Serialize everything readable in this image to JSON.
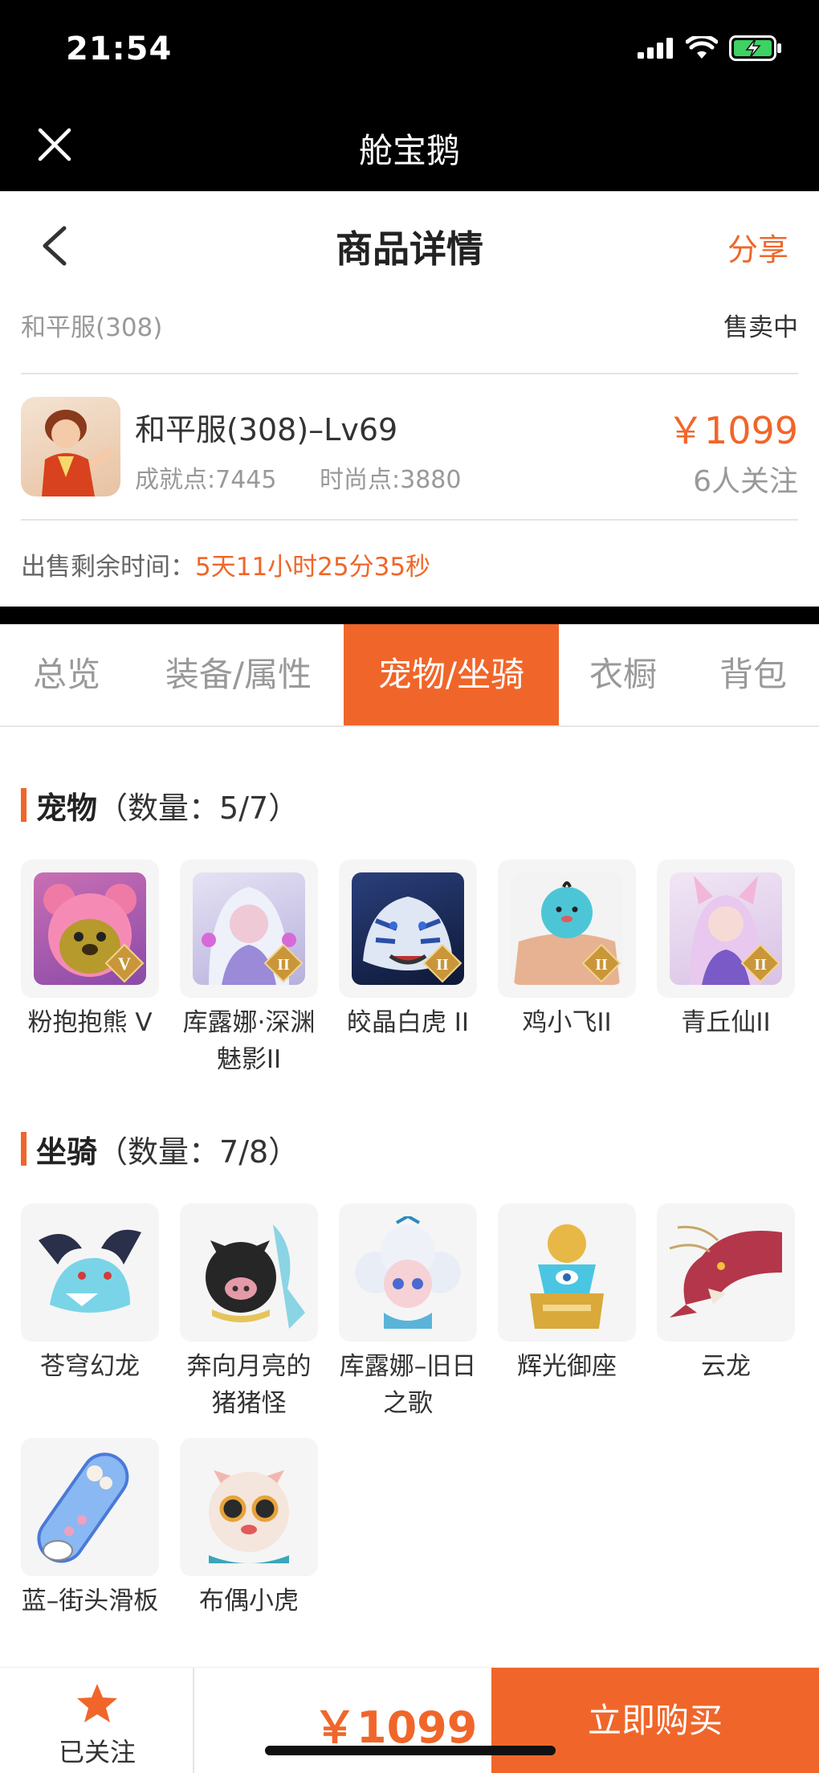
{
  "status_bar": {
    "time": "21:54"
  },
  "app": {
    "title": "舱宝鹅"
  },
  "header": {
    "title": "商品详情",
    "share": "分享"
  },
  "server": {
    "name": "和平服(308)",
    "status": "售卖中"
  },
  "product": {
    "name": "和平服(308)–Lv69",
    "achievement": "成就点:7445",
    "fashion": "时尚点:3880",
    "price": "￥1099",
    "followers": "6人关注"
  },
  "sale_time": {
    "label": "出售剩余时间：",
    "value": "5天11小时25分35秒"
  },
  "tabs": [
    {
      "label": "总览",
      "active": false
    },
    {
      "label": "装备/属性",
      "active": false
    },
    {
      "label": "宠物/坐骑",
      "active": true
    },
    {
      "label": "衣橱",
      "active": false
    },
    {
      "label": "背包",
      "active": false
    }
  ],
  "pets": {
    "title": "宠物",
    "count": "（数量：5/7）",
    "items": [
      {
        "name": "粉抱抱熊 V",
        "badge": "V"
      },
      {
        "name": "库露娜·深渊魅影II",
        "badge": "II"
      },
      {
        "name": "皎晶白虎 II",
        "badge": "II"
      },
      {
        "name": "鸡小飞II",
        "badge": "II"
      },
      {
        "name": "青丘仙II",
        "badge": "II"
      }
    ]
  },
  "mounts": {
    "title": "坐骑",
    "count": "（数量：7/8）",
    "items": [
      {
        "name": "苍穹幻龙"
      },
      {
        "name": "奔向月亮的猪猪怪"
      },
      {
        "name": "库露娜–旧日之歌"
      },
      {
        "name": "辉光御座"
      },
      {
        "name": "云龙"
      },
      {
        "name": "蓝–街头滑板"
      },
      {
        "name": "布偶小虎"
      }
    ]
  },
  "bottom": {
    "follow_label": "已关注",
    "price": "￥1099",
    "buy_label": "立即购买"
  },
  "colors": {
    "accent": "#f0662a"
  }
}
